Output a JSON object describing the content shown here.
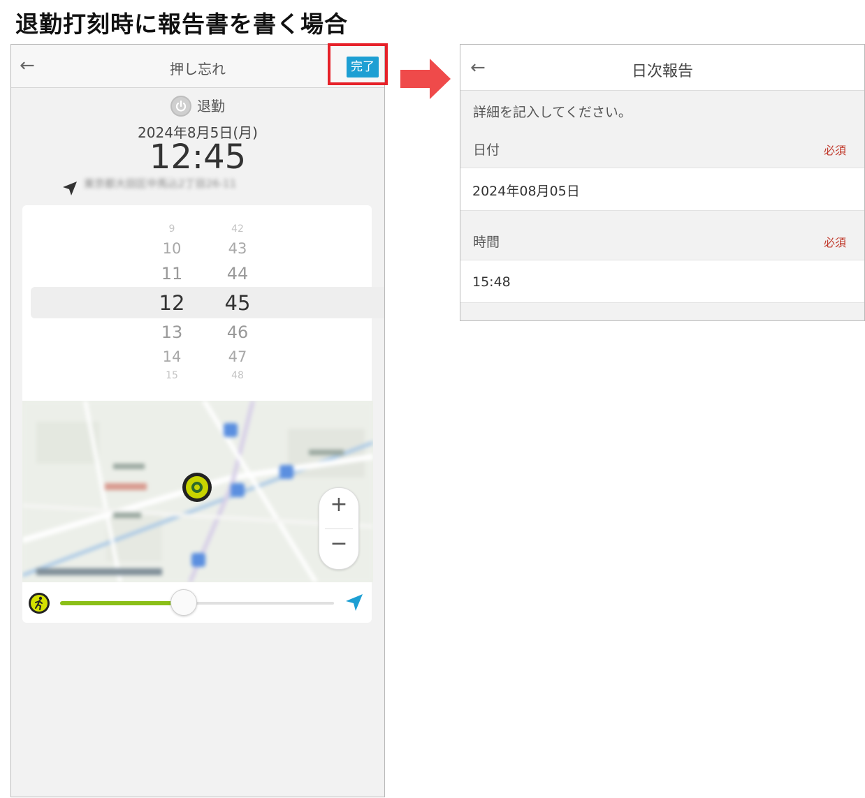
{
  "document": {
    "title": "退勤打刻時に報告書を書く場合"
  },
  "left_screen": {
    "header": {
      "back_icon": "←",
      "title": "押し忘れ",
      "done_label": "完了"
    },
    "punch": {
      "type_label": "退勤",
      "date": "2024年8月5日(月)",
      "time": "12:45",
      "location": "東京都大田区中馬込2丁目26-11"
    },
    "picker": {
      "hours": [
        "9",
        "10",
        "11",
        "12",
        "13",
        "14",
        "15"
      ],
      "minutes": [
        "42",
        "43",
        "44",
        "45",
        "46",
        "47",
        "48"
      ]
    },
    "map": {
      "zoom_in_label": "+",
      "zoom_out_label": "−"
    },
    "slider": {
      "value": 0.45
    },
    "colors": {
      "accent": "#1d9fd3",
      "highlight": "#e62129",
      "slider": "#8bbf18"
    }
  },
  "right_screen": {
    "header": {
      "back_icon": "←",
      "title": "日次報告"
    },
    "instruction": "詳細を記入してください。",
    "date_field": {
      "label": "日付",
      "required": "必須",
      "value": "2024年08月05日"
    },
    "time_field": {
      "label": "時間",
      "required": "必須",
      "value": "15:48"
    }
  }
}
